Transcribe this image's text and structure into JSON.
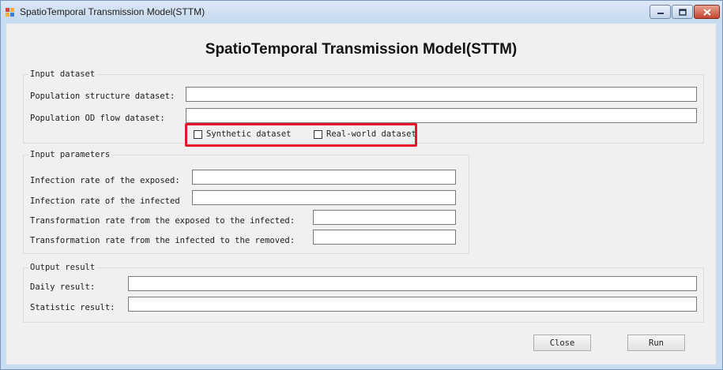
{
  "window": {
    "title": "SpatioTemporal Transmission Model(STTM)"
  },
  "heading": "SpatioTemporal Transmission Model(STTM)",
  "input_dataset": {
    "legend": "Input dataset",
    "population_structure_label": "Population structure dataset:",
    "population_structure_value": "",
    "population_od_label": "Population OD flow dataset:",
    "population_od_value": "",
    "synthetic_label": "Synthetic dataset",
    "realworld_label": "Real-world dataset"
  },
  "input_parameters": {
    "legend": "Input parameters",
    "infection_exposed_label": "Infection rate of the exposed:",
    "infection_exposed_value": "",
    "infection_infected_label": "Infection rate of the infected",
    "infection_infected_value": "",
    "transform_exposed_label": "Transformation rate from the exposed to the infected:",
    "transform_exposed_value": "",
    "transform_infected_label": "Transformation rate from the infected to the removed:",
    "transform_infected_value": ""
  },
  "output_result": {
    "legend": "Output result",
    "daily_label": "Daily result:",
    "daily_value": "",
    "statistic_label": "Statistic result:",
    "statistic_value": ""
  },
  "buttons": {
    "close_label": "Close",
    "run_label": "Run"
  },
  "colors": {
    "highlight": "#e8142a",
    "titlebar": "#c6d9ef",
    "client_bg": "#f0f0f0"
  }
}
